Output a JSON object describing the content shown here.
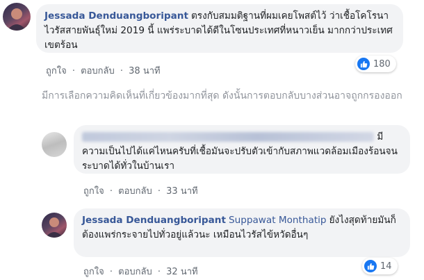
{
  "comment1": {
    "author": "Jessada Denduangboripant",
    "text": "ตรงกับสมมติฐานที่ผมเคยโพสต์ไว้ ว่าเชื้อโคโรนาไวรัสสายพันธุ์ใหม่ 2019 นี้ แพร่ระบาดได้ดีในโซนประเทศที่หนาวเย็น มากกว่าประเทศเขตร้อน",
    "like_label": "ถูกใจ",
    "reply_label": "ตอบกลับ",
    "time": "38 นาที",
    "reaction_count": "180"
  },
  "notice": "มีการเลือกความคิดเห็นที่เกี่ยวข้องมากที่สุด ดังนั้นการตอบกลับบางส่วนอาจถูกกรองออก",
  "reply1": {
    "text": "มีความเป็นไปได้แค่ไหนครับที่เชื้อมันจะปรับตัวเข้ากับสภาพแวดล้อมเมืองร้อนจนระบาดได้ทั่วในบ้านเรา",
    "like_label": "ถูกใจ",
    "reply_label": "ตอบกลับ",
    "time": "33 นาที"
  },
  "reply2": {
    "author": "Jessada Denduangboripant",
    "tag": "Suppawat Monthatip",
    "text": "ยังไงสุดท้ายมันก็ต้องแพร่กระจายไปทั่วอยู่แล้วนะ เหมือนไวรัสไข้หวัดอื่นๆ",
    "like_label": "ถูกใจ",
    "reply_label": "ตอบกลับ",
    "time": "32 นาที",
    "reaction_count": "14"
  },
  "separator": "·",
  "icons": {
    "reaction": "like-thumb-icon"
  },
  "colors": {
    "link": "#385898",
    "bubble": "#f2f3f5",
    "meta": "#606770",
    "like": "#1877f2"
  }
}
